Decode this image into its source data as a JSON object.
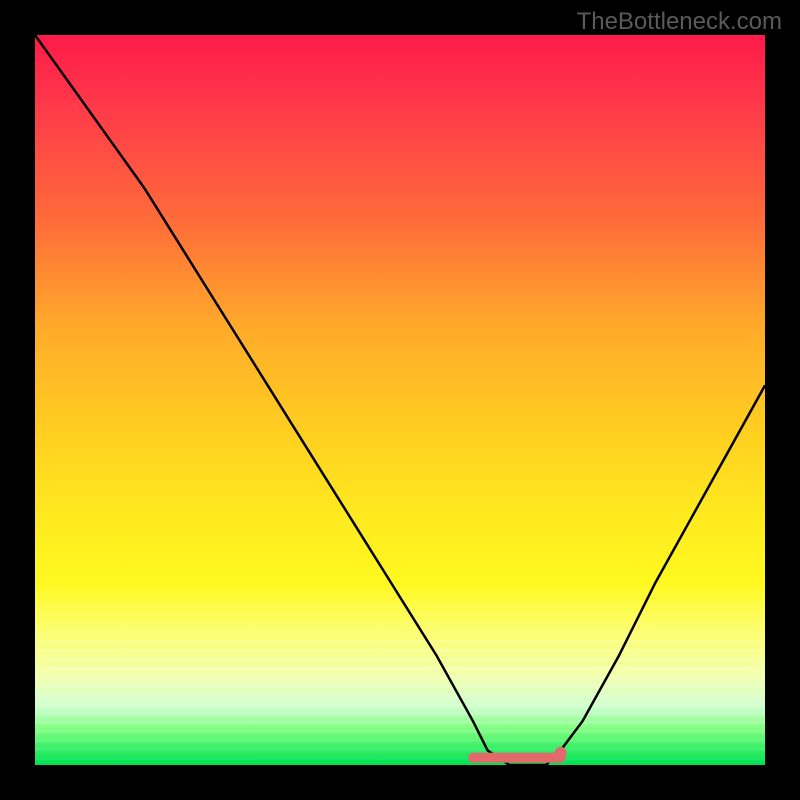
{
  "watermark": "TheBottleneck.com",
  "chart_data": {
    "type": "line",
    "title": "",
    "xlabel": "",
    "ylabel": "",
    "xlim": [
      0,
      100
    ],
    "ylim": [
      0,
      100
    ],
    "x": [
      0,
      5,
      10,
      15,
      20,
      25,
      30,
      35,
      40,
      45,
      50,
      55,
      60,
      62,
      65,
      70,
      72,
      75,
      80,
      85,
      90,
      95,
      100
    ],
    "values": [
      100,
      93,
      86,
      79,
      71,
      63,
      55,
      47,
      39,
      31,
      23,
      15,
      6,
      2,
      0,
      0,
      2,
      6,
      15,
      25,
      34,
      43,
      52
    ],
    "valley_marker": {
      "x_start": 60,
      "x_end": 72,
      "y": 1
    },
    "gradient_stops": [
      {
        "pct": 0,
        "color": "#ff1a4a"
      },
      {
        "pct": 40,
        "color": "#ffaa2a"
      },
      {
        "pct": 75,
        "color": "#fff820"
      },
      {
        "pct": 100,
        "color": "#00e050"
      }
    ]
  }
}
